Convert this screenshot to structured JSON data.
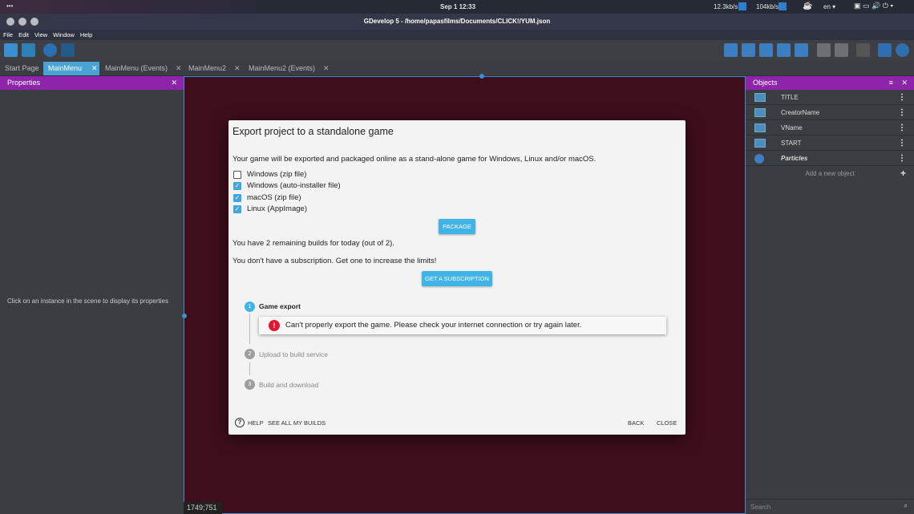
{
  "system": {
    "menu_dots": "•••",
    "datetime": "Sep 1  12:33",
    "net_down": "12.3kb/s",
    "net_up": "104kb/s",
    "lang": "en ▾"
  },
  "window": {
    "title": "GDevelop 5 - /home/papasfilms/Documents/CLICK!/YUM.json"
  },
  "menu": [
    "File",
    "Edit",
    "View",
    "Window",
    "Help"
  ],
  "tabs": [
    {
      "label": "Start Page",
      "closable": false
    },
    {
      "label": "MainMenu",
      "active": true
    },
    {
      "label": "MainMenu (Events)"
    },
    {
      "label": "MainMenu2"
    },
    {
      "label": "MainMenu2 (Events)"
    }
  ],
  "properties": {
    "title": "Properties",
    "hint": "Click on an instance in the scene to display its properties"
  },
  "scene": {
    "coords": "1749;751"
  },
  "objects": {
    "title": "Objects",
    "items": [
      "TITLE",
      "CreatorName",
      "VName",
      "START",
      "Particles"
    ],
    "add_label": "Add a new object",
    "search_placeholder": "Search"
  },
  "dialog": {
    "title": "Export project to a standalone game",
    "intro": "Your game will be exported and packaged online as a stand-alone game for Windows, Linux and/or macOS.",
    "options": [
      {
        "label": "Windows (zip file)",
        "checked": false
      },
      {
        "label": "Windows (auto-installer file)",
        "checked": true
      },
      {
        "label": "macOS (zip file)",
        "checked": true
      },
      {
        "label": "Linux (AppImage)",
        "checked": true
      }
    ],
    "package_label": "PACKAGE",
    "remaining": "You have 2 remaining builds for today (out of 2).",
    "subscription_text": "You don't have a subscription. Get one to increase the limits!",
    "subscription_button": "GET A SUBSCRIPTION",
    "steps": [
      {
        "num": "1",
        "label": "Game export"
      },
      {
        "num": "2",
        "label": "Upload to build service"
      },
      {
        "num": "3",
        "label": "Build and download"
      }
    ],
    "error": "Can't properly export the game. Please check your internet connection or try again later.",
    "help": "HELP",
    "see_builds": "SEE ALL MY BUILDS",
    "back": "BACK",
    "close": "CLOSE"
  },
  "colors": {
    "accent": "#40b4e6",
    "panel_header": "#8e24aa",
    "scene_bg": "#3f0e1d",
    "error": "#e0182d"
  }
}
